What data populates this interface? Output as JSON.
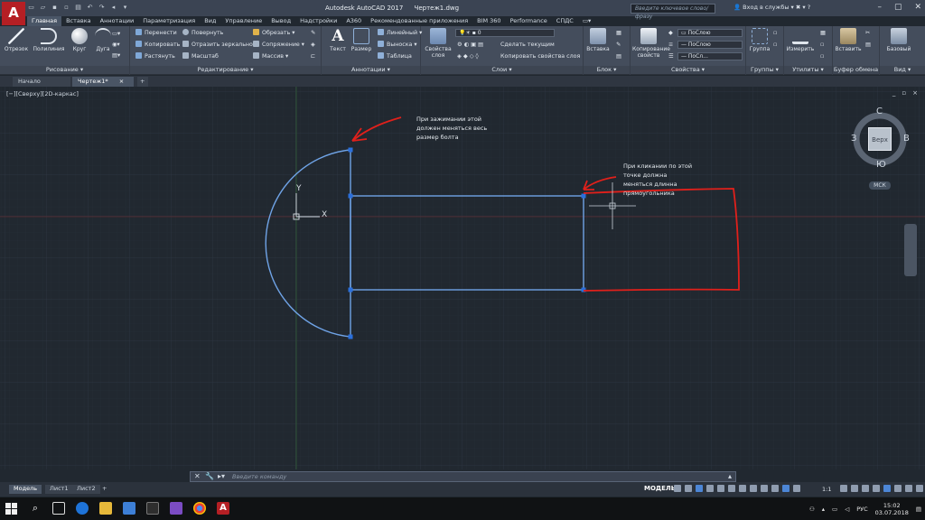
{
  "titlebar": {
    "app_logo": "A",
    "app_title": "Autodesk AutoCAD 2017",
    "file_title": "Чертеж1.dwg",
    "search_placeholder": "Введите ключевое слово/фразу",
    "signin": "Вход в службы"
  },
  "menu_tabs": [
    "Главная",
    "Вставка",
    "Аннотации",
    "Параметризация",
    "Вид",
    "Управление",
    "Вывод",
    "Надстройки",
    "A360",
    "Рекомендованные приложения",
    "BIM 360",
    "Performance",
    "СПДС"
  ],
  "ribbon": {
    "draw": {
      "title": "Рисование",
      "line": "Отрезок",
      "polyline": "Полилиния",
      "circle": "Круг",
      "arc": "Дуга"
    },
    "modify": {
      "title": "Редактирование",
      "move": "Перенести",
      "copy": "Копировать",
      "stretch": "Растянуть",
      "rotate": "Повернуть",
      "mirror": "Отразить зеркально",
      "scale": "Масштаб",
      "trim": "Обрезать",
      "fillet": "Сопряжение",
      "array": "Массив"
    },
    "annotation": {
      "title": "Аннотации",
      "text": "Текст",
      "dimension": "Размер",
      "linear": "Линейный",
      "leader": "Выноска",
      "table": "Таблица"
    },
    "layers": {
      "title": "Слои",
      "properties": "Свойства слоя",
      "layer_value": "0",
      "make_current": "Сделать текущим",
      "match": "Копировать свойства слоя"
    },
    "block": {
      "title": "Блок",
      "insert": "Вставка"
    },
    "properties": {
      "title": "Свойства",
      "match_props": "Копирование свойств",
      "bylayer1": "ПоСлою",
      "bylayer2": "ПоСлою",
      "bylayer3": "ПоСл..."
    },
    "groups": {
      "title": "Группы",
      "group": "Группа"
    },
    "utilities": {
      "title": "Утилиты",
      "measure": "Измерить"
    },
    "clipboard": {
      "title": "Буфер обмена",
      "paste": "Вставить"
    },
    "view": {
      "title": "Вид",
      "base": "Базовый"
    }
  },
  "file_tabs": {
    "start": "Начало",
    "drawing": "Чертеж1*",
    "add": "+"
  },
  "viewport": {
    "label": "[−][Сверху][2D-каркас]",
    "controls": [
      "_",
      "▫",
      "×"
    ]
  },
  "annotations": {
    "note1_l1": "При зажимании этой",
    "note1_l2": "должен меняться весь",
    "note1_l3": "размер болта",
    "note2_l1": "При кликании по этой",
    "note2_l2": "точке должна",
    "note2_l3": "меняться длинна",
    "note2_l4": "прямоугольника"
  },
  "ucs": {
    "x": "X",
    "y": "Y"
  },
  "viewcube": {
    "top": "Верх",
    "north": "С",
    "south": "Ю",
    "west": "З",
    "east": "В",
    "ucs_label": "МСК"
  },
  "command_line": {
    "placeholder": "Введите команду"
  },
  "layout_tabs": {
    "model": "Модель",
    "sheet1": "Лист1",
    "sheet2": "Лист2",
    "add": "+"
  },
  "status": {
    "model": "МОДЕЛЬ",
    "scale": "1:1"
  },
  "tray": {
    "lang": "РУС",
    "time": "15:02",
    "date": "03.07.2018"
  },
  "colors": {
    "accent_red": "#b51f24",
    "geometry_blue": "#6fa3e6",
    "markup_red": "#e0201b",
    "grip_blue": "#2a6fdc"
  }
}
